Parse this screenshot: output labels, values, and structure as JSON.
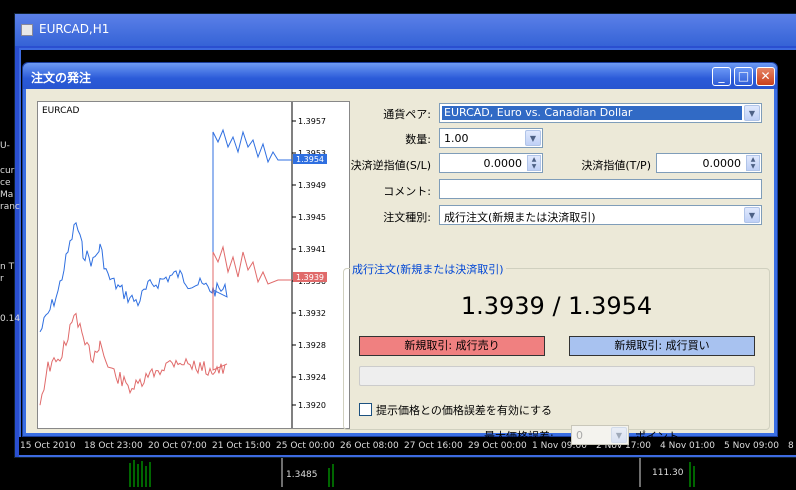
{
  "background_window": {
    "title": "EURCAD,H1",
    "left_panel_texts": [
      "U-",
      "cur",
      "ce",
      "Ma",
      "ranc",
      "n T",
      "r",
      "0.14"
    ],
    "time_axis": [
      "15 Oct 2010",
      "18 Oct 23:00",
      "20 Oct 07:00",
      "21 Oct 15:00",
      "25 Oct 00:00",
      "26 Oct 08:00",
      "27 Oct 16:00",
      "29 Oct 00:00",
      "1 Nov 09:00",
      "2 Nov 17:00",
      "4 Nov 01:00",
      "5 Nov 09:00",
      "8"
    ],
    "bottom_labels": [
      "1.3485",
      "111.30"
    ]
  },
  "dialog": {
    "title": "注文の発注",
    "buttons": {
      "minimize": "_",
      "maximize": "□",
      "close": "✕"
    },
    "chart": {
      "symbol": "EURCAD",
      "price_labels": [
        "1.3957",
        "1.3953",
        "1.3949",
        "1.3945",
        "1.3941",
        "1.3936",
        "1.3932",
        "1.3928",
        "1.3924",
        "1.3920"
      ],
      "ask_tag": "1.3954",
      "bid_tag": "1.3939",
      "ask_color": "#2f6fe0",
      "bid_color": "#e06a6a"
    },
    "form": {
      "symbol_label": "通貨ペア:",
      "symbol_value": "EURCAD, Euro vs. Canadian Dollar",
      "volume_label": "数量:",
      "volume_value": "1.00",
      "sl_label": "決済逆指値(S/L)",
      "sl_value": "0.0000",
      "tp_label": "決済指値(T/P)",
      "tp_value": "0.0000",
      "comment_label": "コメント:",
      "comment_value": "",
      "type_label": "注文種別:",
      "type_value": "成行注文(新規または決済取引)"
    },
    "market": {
      "group_title": "成行注文(新規または決済取引)",
      "price": "1.3939 / 1.3954",
      "sell_label": "新規取引:  成行売り",
      "buy_label": "新規取引:  成行買い",
      "deviation_check_label": "提示価格との価格誤差を有効にする",
      "max_deviation_label": "最大価格誤差:",
      "max_deviation_value": "0",
      "points_label": "ポイント"
    }
  }
}
